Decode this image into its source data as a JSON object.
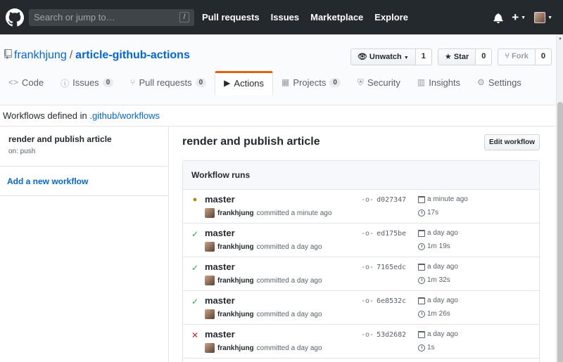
{
  "header": {
    "search_placeholder": "Search or jump to…",
    "search_shortcut": "/",
    "nav": [
      "Pull requests",
      "Issues",
      "Marketplace",
      "Explore"
    ],
    "icons": [
      "octocat-logo-icon",
      "bell-icon",
      "plus-icon",
      "avatar"
    ]
  },
  "repo": {
    "owner": "frankhjung",
    "separator": "/",
    "name": "article-github-actions",
    "watch": {
      "label": "Unwatch",
      "count": "1"
    },
    "star": {
      "label": "Star",
      "count": "0"
    },
    "fork": {
      "label": "Fork",
      "count": "0"
    }
  },
  "tabs": [
    {
      "label": "Code",
      "icon": "code-icon",
      "counter": ""
    },
    {
      "label": "Issues",
      "icon": "issue-icon",
      "counter": "0"
    },
    {
      "label": "Pull requests",
      "icon": "pr-icon",
      "counter": "0"
    },
    {
      "label": "Actions",
      "icon": "play-icon",
      "counter": "",
      "selected": true
    },
    {
      "label": "Projects",
      "icon": "project-icon",
      "counter": "0"
    },
    {
      "label": "Security",
      "icon": "shield-icon",
      "counter": ""
    },
    {
      "label": "Insights",
      "icon": "graph-icon",
      "counter": ""
    },
    {
      "label": "Settings",
      "icon": "gear-icon",
      "counter": ""
    }
  ],
  "subhead": {
    "prefix": "Workflows defined in ",
    "link": ".github/workflows"
  },
  "sidebar": {
    "workflow_name": "render and publish article",
    "workflow_trigger": "on: push",
    "add_label": "Add a new workflow"
  },
  "main": {
    "title": "render and publish article",
    "edit_label": "Edit workflow",
    "runs_header": "Workflow runs"
  },
  "runs": [
    {
      "status": "in-progress",
      "branch": "master",
      "author": "frankhjung",
      "committed": "committed a minute ago",
      "sha": "d027347",
      "when": "a minute ago",
      "duration": "17s"
    },
    {
      "status": "success",
      "branch": "master",
      "author": "frankhjung",
      "committed": "committed a day ago",
      "sha": "ed175be",
      "when": "a day ago",
      "duration": "1m 19s"
    },
    {
      "status": "success",
      "branch": "master",
      "author": "frankhjung",
      "committed": "committed a day ago",
      "sha": "7165edc",
      "when": "a day ago",
      "duration": "1m 32s"
    },
    {
      "status": "success",
      "branch": "master",
      "author": "frankhjung",
      "committed": "committed a day ago",
      "sha": "6e8532c",
      "when": "a day ago",
      "duration": "1m 26s"
    },
    {
      "status": "failure",
      "branch": "master",
      "author": "frankhjung",
      "committed": "committed a day ago",
      "sha": "53d2682",
      "when": "a day ago",
      "duration": "1s"
    }
  ],
  "colors": {
    "header_bg": "#24292e",
    "link": "#0366d6",
    "tab_accent": "#e36209",
    "success": "#28a745",
    "failure": "#cb2431",
    "pending": "#b08800"
  }
}
